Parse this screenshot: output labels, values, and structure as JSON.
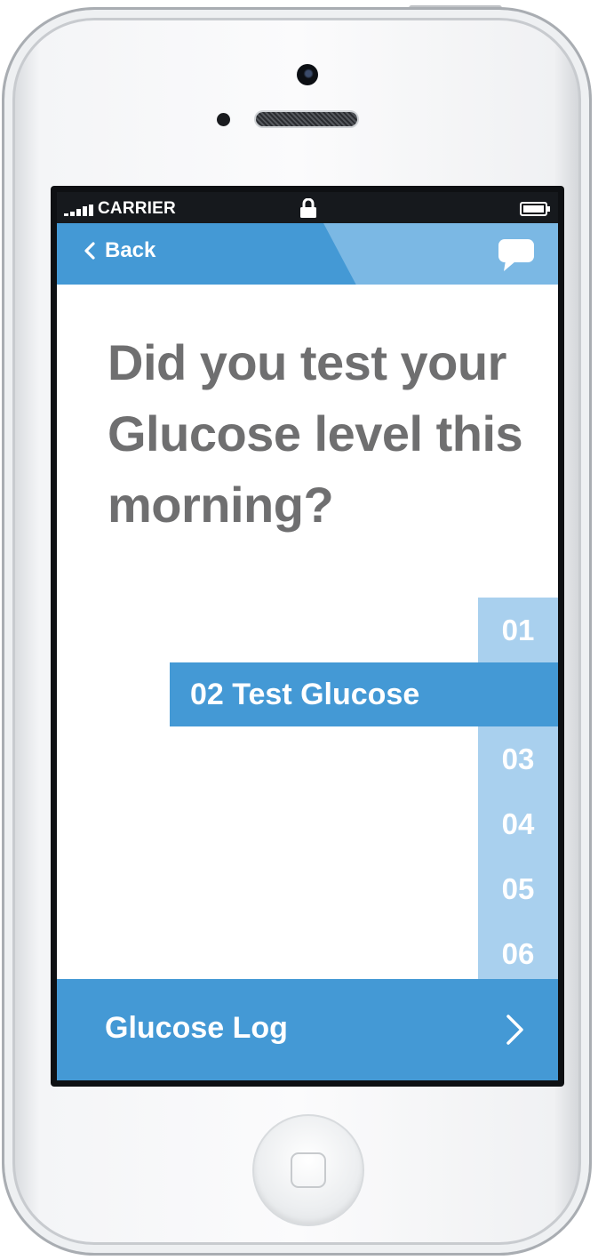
{
  "status_bar": {
    "carrier": "CARRIER",
    "icons": [
      "signal-icon",
      "lock-icon",
      "battery-icon"
    ]
  },
  "nav": {
    "back_label": "Back",
    "back_icon": "chevron-left-icon",
    "action_icon": "chat-bubble-icon"
  },
  "question": "Did you test your Glucose level this morning?",
  "steps": {
    "items": [
      "01",
      "02 Test Glucose",
      "03",
      "04",
      "05",
      "06"
    ],
    "active_index": 1
  },
  "footer": {
    "label": "Glucose Log",
    "icon": "chevron-right-icon"
  },
  "colors": {
    "primary": "#4499d5",
    "step_inactive": "#a9d0ee",
    "question_text": "#6f6f70",
    "nav_tint": "#7bb8e4"
  }
}
